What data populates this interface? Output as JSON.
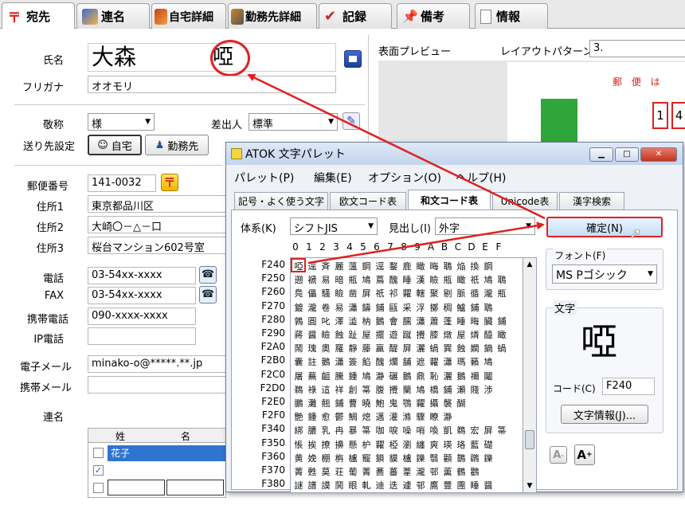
{
  "tabs": [
    {
      "label": "宛先",
      "color": "#d22"
    },
    {
      "label": "連名",
      "color": "#3a6ccf"
    },
    {
      "label": "自宅詳細",
      "color": "#c8401a"
    },
    {
      "label": "勤務先詳細",
      "color": "#c7852b"
    },
    {
      "label": "記録",
      "color": "#c22"
    },
    {
      "label": "備考",
      "color": "#6e8fb8"
    },
    {
      "label": "情報",
      "color": "#888888"
    }
  ],
  "form": {
    "name_label": "氏名",
    "name_value": "大森",
    "name_char": "啞",
    "kana_label": "フリガナ",
    "kana_value": "オオモリ",
    "honorific_label": "敬称",
    "honorific_value": "様",
    "sender_label": "差出人",
    "sender_value": "標準",
    "destination_label": "送り先設定",
    "home_btn": "自宅",
    "work_btn": "勤務先",
    "postal_label": "郵便番号",
    "postal_value": "141-0032",
    "addr1_label": "住所1",
    "addr1_value": "東京都品川区",
    "addr2_label": "住所2",
    "addr2_value": "大崎〇－△－口",
    "addr3_label": "住所3",
    "addr3_value": "桜台マンション602号室",
    "phone_label": "電話",
    "phone_value": "03-54xx-xxxx",
    "fax_label": "FAX",
    "fax_value": "03-54xx-xxxx",
    "mobile_label": "携帯電話",
    "mobile_value": "090-xxxx-xxxx",
    "ip_label": "IP電話",
    "email_label": "電子メール",
    "email_value": "minako-o@*****.**.jp",
    "mobile_email_label": "携帯メール",
    "renmei_label": "連名",
    "renmei_col_sei": "姓",
    "renmei_col_mei": "名",
    "renmei_row1": "花子"
  },
  "preview": {
    "label": "表面プレビュー",
    "layout_label": "レイアウトパターン",
    "layout_value": "3.",
    "postcard_text": "郵 便 は",
    "postcard_digits": [
      "1",
      "4"
    ]
  },
  "atok": {
    "title": "ATOK 文字パレット",
    "menu": [
      "パレット(P)",
      "編集(E)",
      "オプション(O)",
      "ヘルプ(H)"
    ],
    "tabs": [
      "記号・よく使う文字",
      "欧文コード表",
      "和文コード表",
      "Unicode表",
      "漢字検索"
    ],
    "system_label": "体系(K)",
    "system_value": "シフトJIS",
    "heading_label": "見出し(I)",
    "heading_value": "外字",
    "confirm_button": "確定(N)",
    "font_label": "フォント(F)",
    "font_value": "MS Pゴシック",
    "char_label": "文字",
    "char_value": "啞",
    "code_label": "コード(C)",
    "code_value": "F240",
    "char_info_button": "文字情報(J)...",
    "col_headers": [
      "0",
      "1",
      "2",
      "3",
      "4",
      "5",
      "6",
      "7",
      "8",
      "9",
      "A",
      "B",
      "C",
      "D",
      "E",
      "F"
    ],
    "rows": [
      {
        "code": "F240",
        "chars": "啞逕斉麗薀鋼逕鍪鹿瞰晦鵈焔換鋼"
      },
      {
        "code": "F250",
        "chars": "遡褫易暗瓶鳩蔦醜睡漢瞼瓶瞰祇鳩鵈"
      },
      {
        "code": "F260",
        "chars": "鳧儡騒瞼凿屏祇祁糶轄聚剔脈循瀧瓶"
      },
      {
        "code": "F270",
        "chars": "鍍瀧卷易瀟鑄鋪甌采浮擲稠鱸鋪鵈"
      },
      {
        "code": "F280",
        "chars": "鶉圓叱澤澁枘鵝會臑瀟蕭蓬睡晦臟鋪"
      },
      {
        "code": "F290",
        "chars": "蔣醤瞼蝕趾屋擺遊蹴攪膝燉屋燐醯瞰"
      },
      {
        "code": "F2A0",
        "chars": "鬧瑰奧羅靜藤贏醍屏灑蝸巽蝕嫻鏑蝸"
      },
      {
        "code": "F2B0",
        "chars": "囊註鵝瀟簽餡醜爛舗遮糶瀟瑪籟鳩"
      },
      {
        "code": "F2C0",
        "chars": "屠蕪齟騰鍾鳩瀞碾鵝鼎恥灑鵝禰鬮"
      },
      {
        "code": "F2D0",
        "chars": "鵜祿這祥創箒腹攪蘭鳩橋鋪瀬賤渉"
      },
      {
        "code": "F2E0",
        "chars": "鵬灘翹鋪曹曉鮑鬼鶚糶攝襲醐"
      },
      {
        "code": "F2F0",
        "chars": "艶鍾愈鬱鯛熄邁灌滌驟瞭瀞"
      },
      {
        "code": "F340",
        "chars": "綁膿乳冉暴箒咖唳噪哨喚凱鵜宏屏箒"
      },
      {
        "code": "F350",
        "chars": "悵挨撩擤懸枦糶椏瀏纏爽瑛珞藍礎"
      },
      {
        "code": "F360",
        "chars": "黄娩棚栴櫨寵鎖貘櫨鑠翳顴鵲鸊鑠"
      },
      {
        "code": "F370",
        "chars": "菁甦莫荘葡菁蕎蕃葦瀧邨薫鶴鸛"
      },
      {
        "code": "F380",
        "chars": "謎譜謨鬨眼軋迪迭遽邨鷹豐團睡醤"
      }
    ]
  }
}
